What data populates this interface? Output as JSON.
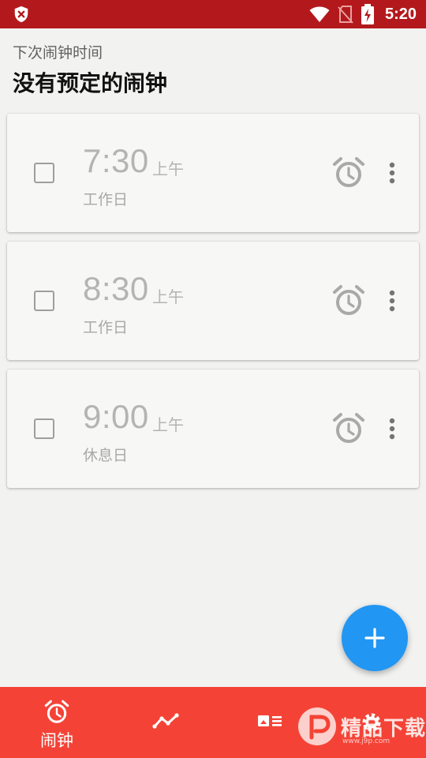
{
  "status_bar": {
    "time": "5:20",
    "icons": [
      "shield-x-icon",
      "wifi-icon",
      "no-sim-icon",
      "battery-charging-icon"
    ]
  },
  "header": {
    "next_alarm_label": "下次闹钟时间",
    "next_alarm_value": "没有预定的闹钟"
  },
  "alarms": [
    {
      "time": "7:30",
      "ampm": "上午",
      "repeat": "工作日",
      "enabled": false
    },
    {
      "time": "8:30",
      "ampm": "上午",
      "repeat": "工作日",
      "enabled": false
    },
    {
      "time": "9:00",
      "ampm": "上午",
      "repeat": "休息日",
      "enabled": false
    }
  ],
  "fab": {
    "icon": "plus-icon"
  },
  "bottom_nav": {
    "items": [
      {
        "icon": "alarm-clock-icon",
        "label": "闹钟",
        "active": true
      },
      {
        "icon": "trend-chart-icon",
        "label": ""
      },
      {
        "icon": "card-list-icon",
        "label": ""
      },
      {
        "icon": "gear-icon",
        "label": ""
      }
    ]
  },
  "watermark": {
    "text": "精品下载",
    "url": "www.j9p.com"
  },
  "colors": {
    "status_bar": "#b3191c",
    "bottom_nav": "#f44336",
    "fab": "#2196f3",
    "card_bg": "#f7f7f6",
    "page_bg": "#f2f2f1"
  }
}
